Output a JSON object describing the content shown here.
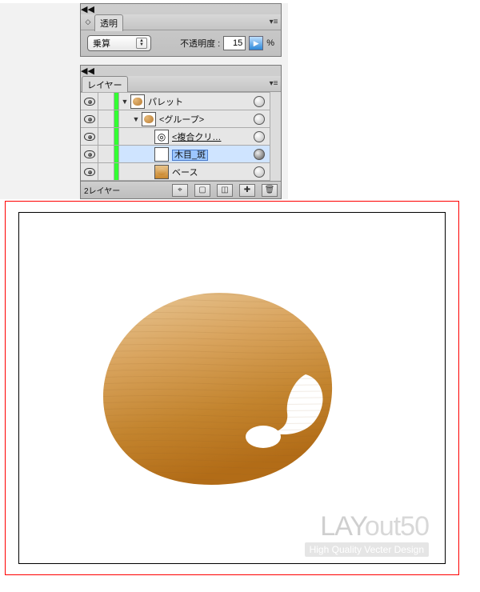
{
  "transparency_panel": {
    "title": "透明",
    "blend_mode": "乗算",
    "opacity_label": "不透明度 :",
    "opacity_value": "15",
    "opacity_unit": "%"
  },
  "layers_panel": {
    "title": "レイヤー",
    "rows": [
      {
        "name": "パレット",
        "indent": 0,
        "twisty": "down",
        "thumb": "palette-ic",
        "target": "norm",
        "selected": false,
        "underline": false
      },
      {
        "name": "<グループ>",
        "indent": 1,
        "twisty": "down",
        "thumb": "palette-ic",
        "target": "norm",
        "selected": false,
        "underline": false
      },
      {
        "name": "<複合クリ…",
        "indent": 2,
        "twisty": "",
        "thumb": "clip",
        "target": "norm",
        "selected": false,
        "underline": true
      },
      {
        "name": "木目_斑",
        "indent": 2,
        "twisty": "",
        "thumb": "white",
        "target": "solid",
        "selected": true,
        "underline": false
      },
      {
        "name": "ベース",
        "indent": 2,
        "twisty": "",
        "thumb": "wood",
        "target": "norm",
        "selected": false,
        "underline": false
      }
    ],
    "footer_count": "2レイヤー"
  },
  "watermark": {
    "line1a": "LAY",
    "line1b": "out50",
    "line2": "High Quality Vecter Design"
  },
  "icons": {
    "make_clip": "⬚",
    "new_sublayer": "⧉",
    "new_layer": "＋",
    "trash": "🗑"
  }
}
